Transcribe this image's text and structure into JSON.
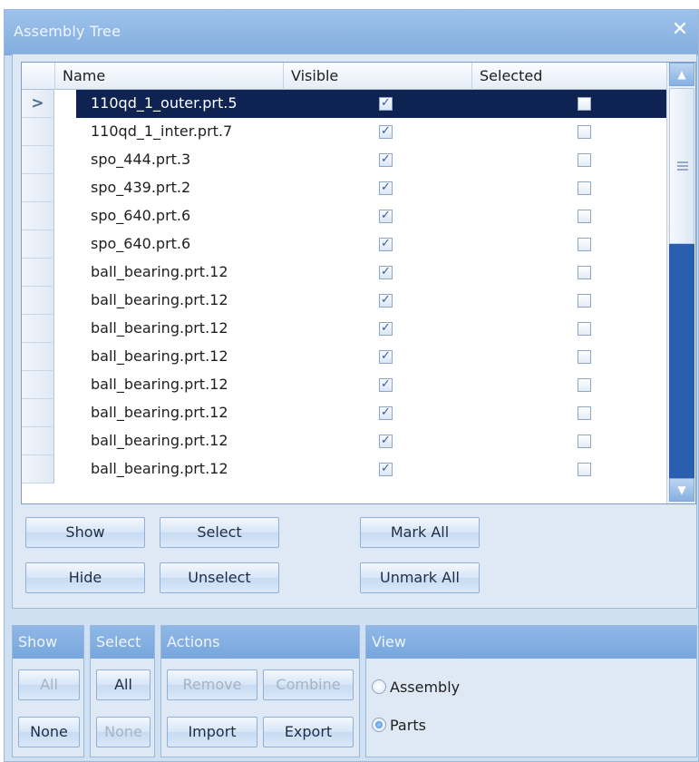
{
  "window": {
    "title": "Assembly Tree",
    "close_icon": "close-icon"
  },
  "grid": {
    "columns": [
      "Name",
      "Visible",
      "Selected"
    ],
    "current_row_marker": ">",
    "rows": [
      {
        "name": "110qd_1_outer.prt.5",
        "visible": true,
        "selected": false,
        "current": true
      },
      {
        "name": "110qd_1_inter.prt.7",
        "visible": true,
        "selected": false
      },
      {
        "name": "spo_444.prt.3",
        "visible": true,
        "selected": false
      },
      {
        "name": "spo_439.prt.2",
        "visible": true,
        "selected": false
      },
      {
        "name": "spo_640.prt.6",
        "visible": true,
        "selected": false
      },
      {
        "name": "spo_640.prt.6",
        "visible": true,
        "selected": false
      },
      {
        "name": "ball_bearing.prt.12",
        "visible": true,
        "selected": false
      },
      {
        "name": "ball_bearing.prt.12",
        "visible": true,
        "selected": false
      },
      {
        "name": "ball_bearing.prt.12",
        "visible": true,
        "selected": false
      },
      {
        "name": "ball_bearing.prt.12",
        "visible": true,
        "selected": false
      },
      {
        "name": "ball_bearing.prt.12",
        "visible": true,
        "selected": false
      },
      {
        "name": "ball_bearing.prt.12",
        "visible": true,
        "selected": false
      },
      {
        "name": "ball_bearing.prt.12",
        "visible": true,
        "selected": false
      },
      {
        "name": "ball_bearing.prt.12",
        "visible": true,
        "selected": false
      }
    ]
  },
  "grid_buttons": {
    "show": "Show",
    "select": "Select",
    "mark_all": "Mark All",
    "hide": "Hide",
    "unselect": "Unselect",
    "unmark_all": "Unmark All"
  },
  "groups": {
    "show": {
      "title": "Show",
      "all": "All",
      "none": "None"
    },
    "select": {
      "title": "Select",
      "all": "All",
      "none": "None"
    },
    "actions": {
      "title": "Actions",
      "remove": "Remove",
      "combine": "Combine",
      "import": "Import",
      "export": "Export"
    },
    "view": {
      "title": "View",
      "assembly": "Assembly",
      "parts": "Parts",
      "selected": "Parts"
    }
  },
  "colors": {
    "selected_row": "#0f2352",
    "title_bar": "#8fb8e7",
    "scroll_track": "#2a5fb0"
  }
}
